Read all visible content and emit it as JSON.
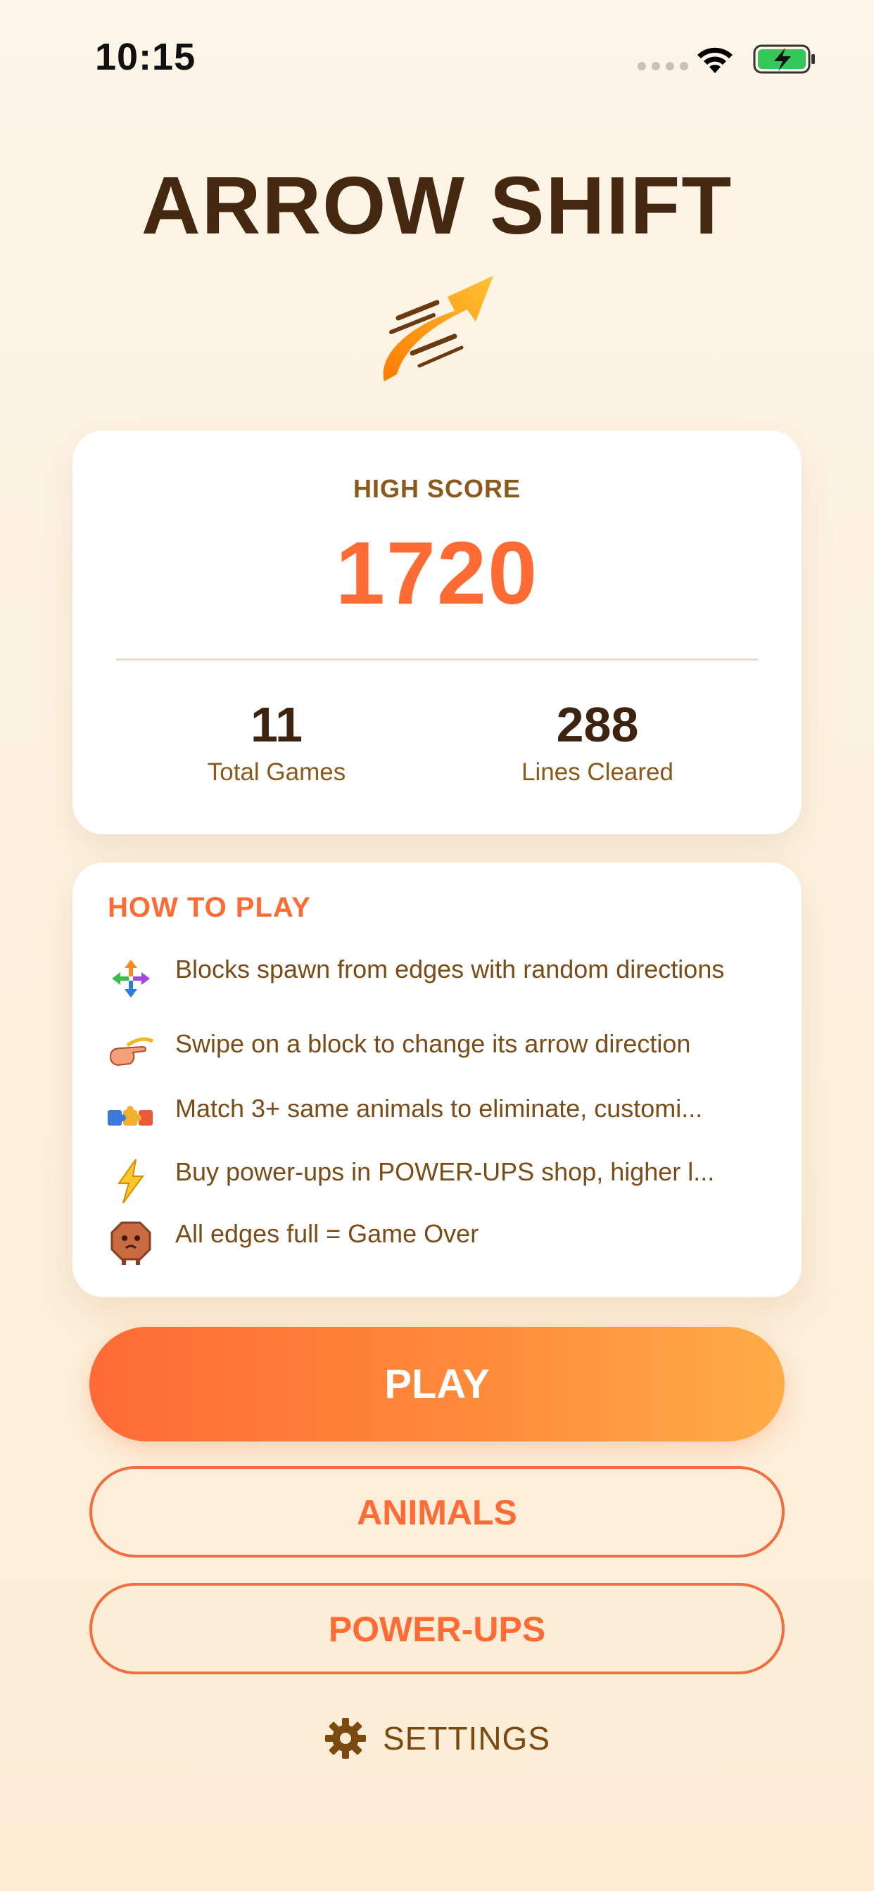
{
  "status_bar": {
    "time": "10:15"
  },
  "app": {
    "title": "ARROW SHIFT"
  },
  "stats": {
    "high_score_label": "HIGH SCORE",
    "high_score": "1720",
    "total_games": "11",
    "total_games_label": "Total Games",
    "lines_cleared": "288",
    "lines_cleared_label": "Lines Cleared"
  },
  "how_to_play": {
    "title": "HOW TO PLAY",
    "rules": [
      {
        "icon": "four-arrows-icon",
        "text": "Blocks spawn from edges with random directions"
      },
      {
        "icon": "swipe-hand-icon",
        "text": "Swipe on a block to change its arrow direction"
      },
      {
        "icon": "puzzle-icon",
        "text": "Match 3+ same animals to eliminate, customi..."
      },
      {
        "icon": "lightning-icon",
        "text": "Buy power-ups in POWER-UPS shop, higher l..."
      },
      {
        "icon": "creature-icon",
        "text": "All edges full = Game Over"
      }
    ]
  },
  "buttons": {
    "play": "PLAY",
    "animals": "ANIMALS",
    "powerups": "POWER-UPS",
    "settings": "SETTINGS"
  },
  "colors": {
    "accent": "#ff6b35",
    "title": "#44280f",
    "text_brown": "#8a5a1c"
  }
}
